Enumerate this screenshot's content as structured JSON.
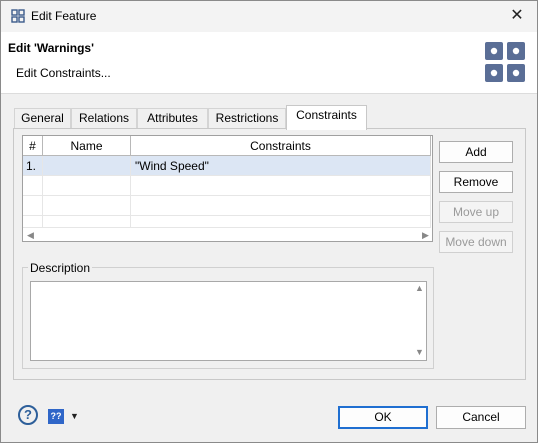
{
  "window": {
    "title": "Edit Feature",
    "close_glyph": "✕"
  },
  "header": {
    "title": "Edit 'Warnings'",
    "subtitle": "Edit Constraints...",
    "logo_icon": "grid-dots-logo-icon",
    "accent": "#5a6e96"
  },
  "tabs": [
    {
      "label": "General"
    },
    {
      "label": "Relations"
    },
    {
      "label": "Attributes"
    },
    {
      "label": "Restrictions"
    },
    {
      "label": "Constraints"
    }
  ],
  "active_tab": "Constraints",
  "table": {
    "columns": [
      "#",
      "Name",
      "Constraints"
    ],
    "rows": [
      {
        "num": "1.",
        "name": "",
        "constraint": "\"Wind Speed\""
      }
    ]
  },
  "buttons": {
    "add": "Add",
    "remove": "Remove",
    "move_up": "Move up",
    "move_down": "Move down"
  },
  "description": {
    "label": "Description",
    "value": ""
  },
  "footer": {
    "help_glyph": "?",
    "kb_glyph": "??",
    "ok": "OK",
    "cancel": "Cancel"
  },
  "colors": {
    "selection": "#dce6f4",
    "ok_border": "#1f6fd1",
    "kb_icon": "#2f66c8"
  }
}
